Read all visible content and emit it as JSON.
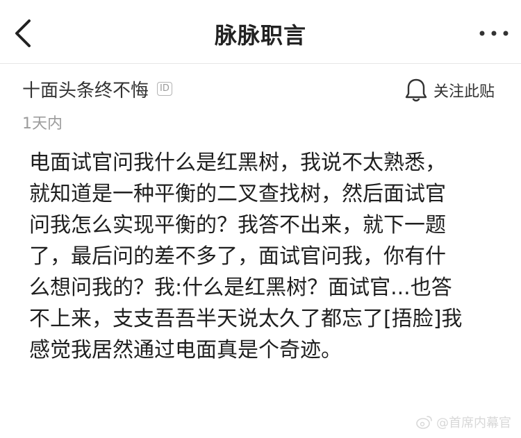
{
  "header": {
    "title": "脉脉职言"
  },
  "post": {
    "author": "十面头条终不悔",
    "id_badge": "ID",
    "follow_label": "关注此贴",
    "time": "1天内",
    "lines": [
      "电面试官问我什么是红黑树，我说不太熟悉，",
      "就知道是一种平衡的二叉查找树，然后面试官",
      "问我怎么实现平衡的？我答不出来，就下一题",
      "了，最后问的差不多了，面试官问我，你有什",
      "么想问我的？我:什么是红黑树？面试官...也答",
      "不上来，支支吾吾半天说太久了都忘了[捂脸]我",
      "感觉我居然通过电面真是个奇迹。"
    ]
  },
  "watermark": {
    "text": "@首席内幕官"
  },
  "icons": {
    "back": "chevron-left-icon",
    "more": "more-dots-icon",
    "follow": "bell-icon",
    "watermark": "weibo-icon"
  }
}
